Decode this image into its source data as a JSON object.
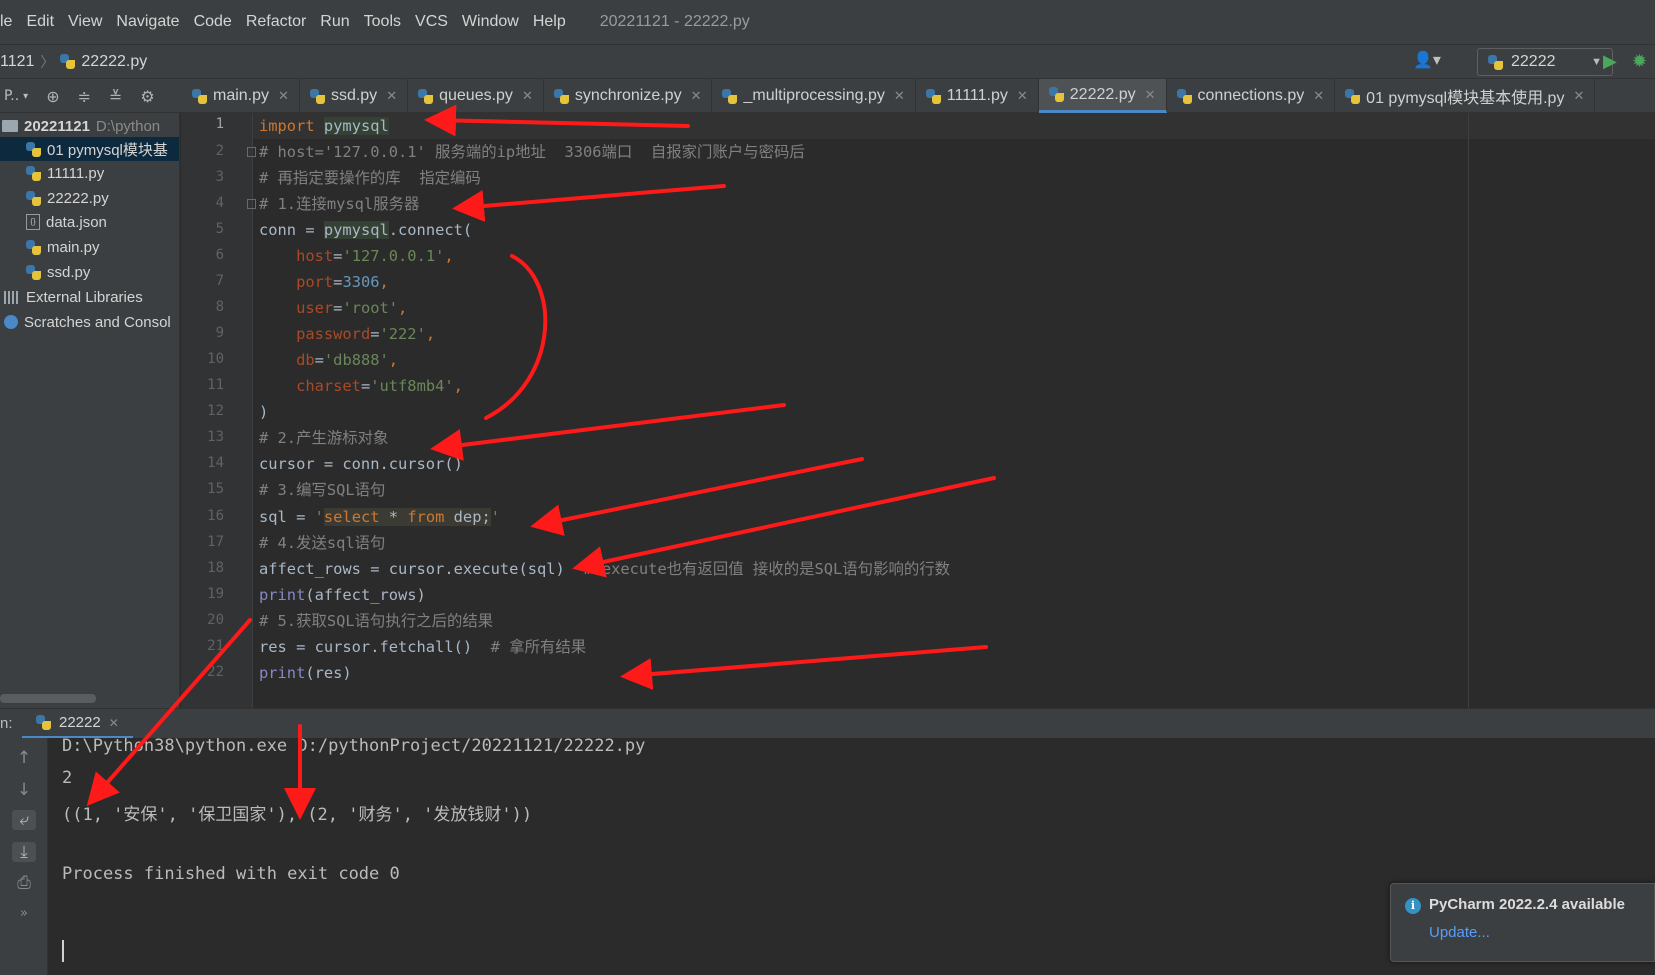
{
  "menubar": {
    "items": [
      "le",
      "Edit",
      "View",
      "Navigate",
      "Code",
      "Refactor",
      "Run",
      "Tools",
      "VCS",
      "Window",
      "Help"
    ],
    "window_title": "20221121 - 22222.py"
  },
  "navbar": {
    "breadcrumb_project": "1121",
    "breadcrumb_file": "22222.py",
    "run_config": "22222"
  },
  "project_toolbar": {
    "label": "P.."
  },
  "tabs": [
    {
      "label": "main.py"
    },
    {
      "label": "ssd.py"
    },
    {
      "label": "queues.py"
    },
    {
      "label": "synchronize.py"
    },
    {
      "label": "_multiprocessing.py"
    },
    {
      "label": "11111.py"
    },
    {
      "label": "22222.py",
      "active": true
    },
    {
      "label": "connections.py"
    },
    {
      "label": "01 pymysql模块基本使用.py"
    }
  ],
  "project_tree": {
    "root_name": "20221121",
    "root_path": "D:\\python",
    "items": [
      {
        "label": "01 pymysql模块基"
      },
      {
        "label": "11111.py"
      },
      {
        "label": "22222.py"
      },
      {
        "label": "data.json"
      },
      {
        "label": "main.py"
      },
      {
        "label": "ssd.py"
      }
    ],
    "external_libraries": "External Libraries",
    "scratches": "Scratches and Consol"
  },
  "editor": {
    "line_numbers": [
      "1",
      "2",
      "3",
      "4",
      "5",
      "6",
      "7",
      "8",
      "9",
      "10",
      "11",
      "12",
      "13",
      "14",
      "15",
      "16",
      "17",
      "18",
      "19",
      "20",
      "21",
      "22"
    ],
    "code": {
      "l1_kw": "import",
      "l1_mod": "pymysql",
      "l2": "# host='127.0.0.1' 服务端的ip地址  3306端口  自报家门账户与密码后",
      "l3": "# 再指定要操作的库  指定编码",
      "l4": "# 1.连接mysql服务器",
      "l5_a": "conn = ",
      "l5_mod": "pymysql",
      "l5_b": ".connect(",
      "l6_p": "host",
      "l6_v": "'127.0.0.1'",
      "l7_p": "port",
      "l7_v": "3306",
      "l8_p": "user",
      "l8_v": "'root'",
      "l9_p": "password",
      "l9_v": "'222'",
      "l10_p": "db",
      "l10_v": "'db888'",
      "l11_p": "charset",
      "l11_v": "'utf8mb4'",
      "l12": ")",
      "l13": "# 2.产生游标对象",
      "l14": "cursor = conn.cursor()",
      "l15": "# 3.编写SQL语句",
      "l16_a": "sql = ",
      "l16_q1": "'",
      "l16_select": "select",
      "l16_star": " * ",
      "l16_from": "from",
      "l16_rest": " dep;",
      "l16_q2": "'",
      "l17": "# 4.发送sql语句",
      "l18_code": "affect_rows = cursor.execute(sql)  ",
      "l18_cmt": "# execute也有返回值 接收的是SQL语句影响的行数",
      "l19_fn": "print",
      "l19_rest": "(affect_rows)",
      "l20": "# 5.获取SQL语句执行之后的结果",
      "l21_code": "res = cursor.fetchall()  ",
      "l21_cmt": "# 拿所有结果",
      "l22_fn": "print",
      "l22_rest": "(res)"
    }
  },
  "run_panel": {
    "label": "n:",
    "tab_label": "22222",
    "console": [
      "D:\\Python38\\python.exe D:/pythonProject/20221121/22222.py",
      "2",
      "((1, '安保', '保卫国家'), (2, '财务', '发放钱财'))",
      "",
      "Process finished with exit code 0"
    ]
  },
  "notification": {
    "title": "PyCharm 2022.2.4 available",
    "link": "Update..."
  },
  "colors": {
    "keyword": "#cc7832",
    "string": "#6a8759",
    "number": "#6897bb",
    "comment": "#808080",
    "param": "#aa4926",
    "annotation_red": "#ff1a1a",
    "accent_blue": "#4a88c7"
  }
}
